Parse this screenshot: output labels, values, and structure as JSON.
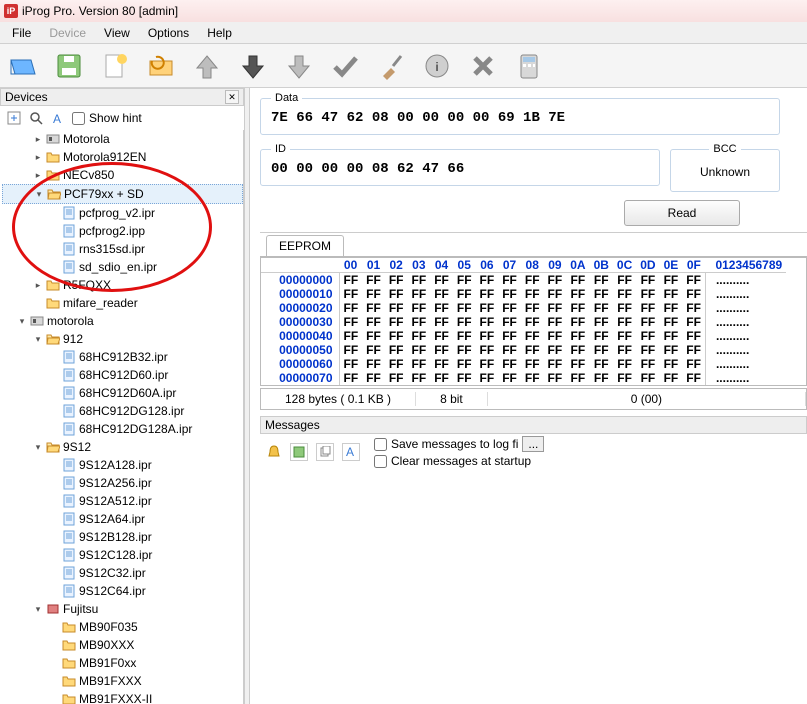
{
  "window": {
    "title": "iProg Pro. Version 80 [admin]",
    "icon_text": "iP"
  },
  "menu": {
    "file": "File",
    "device": "Device",
    "view": "View",
    "options": "Options",
    "help": "Help"
  },
  "devices": {
    "title": "Devices",
    "show_hint": "Show hint",
    "tree": [
      {
        "level": 1,
        "expand": "+",
        "icon": "board",
        "label": "Motorola"
      },
      {
        "level": 1,
        "expand": "+",
        "icon": "folder",
        "label": "Motorola912EN"
      },
      {
        "level": 1,
        "expand": "+",
        "icon": "folder",
        "label": "NECv850"
      },
      {
        "level": 1,
        "expand": "-",
        "icon": "folder-open",
        "label": "PCF79xx + SD",
        "selected": true
      },
      {
        "level": 2,
        "expand": "",
        "icon": "file",
        "label": "pcfprog_v2.ipr"
      },
      {
        "level": 2,
        "expand": "",
        "icon": "file",
        "label": "pcfprog2.ipp"
      },
      {
        "level": 2,
        "expand": "",
        "icon": "file",
        "label": "rns315sd.ipr"
      },
      {
        "level": 2,
        "expand": "",
        "icon": "file",
        "label": "sd_sdio_en.ipr"
      },
      {
        "level": 1,
        "expand": "+",
        "icon": "folder",
        "label": "R5FQXX"
      },
      {
        "level": 1,
        "expand": "",
        "icon": "folder",
        "label": "mifare_reader"
      },
      {
        "level": 0,
        "expand": "-",
        "icon": "board",
        "label": "motorola"
      },
      {
        "level": 1,
        "expand": "-",
        "icon": "folder-open",
        "label": "912"
      },
      {
        "level": 2,
        "expand": "",
        "icon": "file",
        "label": "68HC912B32.ipr"
      },
      {
        "level": 2,
        "expand": "",
        "icon": "file",
        "label": "68HC912D60.ipr"
      },
      {
        "level": 2,
        "expand": "",
        "icon": "file",
        "label": "68HC912D60A.ipr"
      },
      {
        "level": 2,
        "expand": "",
        "icon": "file",
        "label": "68HC912DG128.ipr"
      },
      {
        "level": 2,
        "expand": "",
        "icon": "file",
        "label": "68HC912DG128A.ipr"
      },
      {
        "level": 1,
        "expand": "-",
        "icon": "folder-open",
        "label": "9S12"
      },
      {
        "level": 2,
        "expand": "",
        "icon": "file",
        "label": "9S12A128.ipr"
      },
      {
        "level": 2,
        "expand": "",
        "icon": "file",
        "label": "9S12A256.ipr"
      },
      {
        "level": 2,
        "expand": "",
        "icon": "file",
        "label": "9S12A512.ipr"
      },
      {
        "level": 2,
        "expand": "",
        "icon": "file",
        "label": "9S12A64.ipr"
      },
      {
        "level": 2,
        "expand": "",
        "icon": "file",
        "label": "9S12B128.ipr"
      },
      {
        "level": 2,
        "expand": "",
        "icon": "file",
        "label": "9S12C128.ipr"
      },
      {
        "level": 2,
        "expand": "",
        "icon": "file",
        "label": "9S12C32.ipr"
      },
      {
        "level": 2,
        "expand": "",
        "icon": "file",
        "label": "9S12C64.ipr"
      },
      {
        "level": 1,
        "expand": "-",
        "icon": "chip-red",
        "label": "Fujitsu"
      },
      {
        "level": 2,
        "expand": "",
        "icon": "folder",
        "label": "MB90F035"
      },
      {
        "level": 2,
        "expand": "",
        "icon": "folder",
        "label": "MB90XXX"
      },
      {
        "level": 2,
        "expand": "",
        "icon": "folder",
        "label": "MB91F0xx"
      },
      {
        "level": 2,
        "expand": "",
        "icon": "folder",
        "label": "MB91FXXX"
      },
      {
        "level": 2,
        "expand": "",
        "icon": "folder",
        "label": "MB91FXXX-II"
      }
    ]
  },
  "panel": {
    "data_label": "Data",
    "data_value": "7E 66 47 62 08 00 00 00 00 69 1B 7E",
    "id_label": "ID",
    "id_value": "00 00 00 00 08 62 47 66",
    "bcc_label": "BCC",
    "bcc_value": "Unknown",
    "read_btn": "Read"
  },
  "hex": {
    "tab": "EEPROM",
    "cols": [
      "00",
      "01",
      "02",
      "03",
      "04",
      "05",
      "06",
      "07",
      "08",
      "09",
      "0A",
      "0B",
      "0C",
      "0D",
      "0E",
      "0F"
    ],
    "ascii_header": "0123456789",
    "rows": [
      {
        "offset": "00000000",
        "bytes": [
          "FF",
          "FF",
          "FF",
          "FF",
          "FF",
          "FF",
          "FF",
          "FF",
          "FF",
          "FF",
          "FF",
          "FF",
          "FF",
          "FF",
          "FF",
          "FF"
        ],
        "ascii": ".........."
      },
      {
        "offset": "00000010",
        "bytes": [
          "FF",
          "FF",
          "FF",
          "FF",
          "FF",
          "FF",
          "FF",
          "FF",
          "FF",
          "FF",
          "FF",
          "FF",
          "FF",
          "FF",
          "FF",
          "FF"
        ],
        "ascii": ".........."
      },
      {
        "offset": "00000020",
        "bytes": [
          "FF",
          "FF",
          "FF",
          "FF",
          "FF",
          "FF",
          "FF",
          "FF",
          "FF",
          "FF",
          "FF",
          "FF",
          "FF",
          "FF",
          "FF",
          "FF"
        ],
        "ascii": ".........."
      },
      {
        "offset": "00000030",
        "bytes": [
          "FF",
          "FF",
          "FF",
          "FF",
          "FF",
          "FF",
          "FF",
          "FF",
          "FF",
          "FF",
          "FF",
          "FF",
          "FF",
          "FF",
          "FF",
          "FF"
        ],
        "ascii": ".........."
      },
      {
        "offset": "00000040",
        "bytes": [
          "FF",
          "FF",
          "FF",
          "FF",
          "FF",
          "FF",
          "FF",
          "FF",
          "FF",
          "FF",
          "FF",
          "FF",
          "FF",
          "FF",
          "FF",
          "FF"
        ],
        "ascii": ".........."
      },
      {
        "offset": "00000050",
        "bytes": [
          "FF",
          "FF",
          "FF",
          "FF",
          "FF",
          "FF",
          "FF",
          "FF",
          "FF",
          "FF",
          "FF",
          "FF",
          "FF",
          "FF",
          "FF",
          "FF"
        ],
        "ascii": ".........."
      },
      {
        "offset": "00000060",
        "bytes": [
          "FF",
          "FF",
          "FF",
          "FF",
          "FF",
          "FF",
          "FF",
          "FF",
          "FF",
          "FF",
          "FF",
          "FF",
          "FF",
          "FF",
          "FF",
          "FF"
        ],
        "ascii": ".........."
      },
      {
        "offset": "00000070",
        "bytes": [
          "FF",
          "FF",
          "FF",
          "FF",
          "FF",
          "FF",
          "FF",
          "FF",
          "FF",
          "FF",
          "FF",
          "FF",
          "FF",
          "FF",
          "FF",
          "FF"
        ],
        "ascii": ".........."
      }
    ],
    "status": {
      "size": "128 bytes ( 0.1 KB )",
      "bits": "8 bit",
      "cursor": "0 (00)"
    }
  },
  "messages": {
    "title": "Messages",
    "save_log": "Save messages to log fi",
    "clear_startup": "Clear messages at startup",
    "browse_btn": "..."
  }
}
